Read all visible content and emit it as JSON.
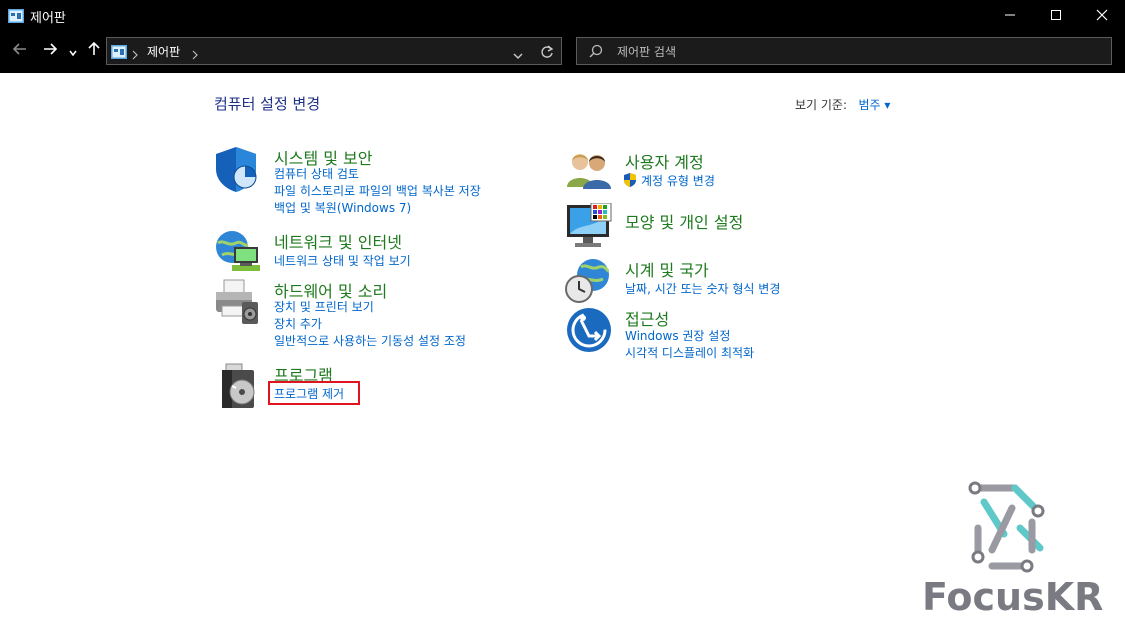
{
  "window": {
    "title": "제어판"
  },
  "address": {
    "crumb": "제어판"
  },
  "search": {
    "placeholder": "제어판 검색"
  },
  "main": {
    "heading": "컴퓨터 설정 변경",
    "view_by_label": "보기 기준:",
    "view_by_value": "범주"
  },
  "categories": [
    {
      "title": "시스템 및 보안",
      "links": [
        "컴퓨터 상태 검토",
        "파일 히스토리로 파일의 백업 복사본 저장",
        "백업 및 복원(Windows 7)"
      ]
    },
    {
      "title": "네트워크 및 인터넷",
      "links": [
        "네트워크 상태 및 작업 보기"
      ]
    },
    {
      "title": "하드웨어 및 소리",
      "links": [
        "장치 및 프린터 보기",
        "장치 추가",
        "일반적으로 사용하는 기동성 설정 조정"
      ]
    },
    {
      "title": "프로그램",
      "links": [
        "프로그램 제거"
      ]
    },
    {
      "title": "사용자 계정",
      "links": [
        "계정 유형 변경"
      ]
    },
    {
      "title": "모양 및 개인 설정",
      "links": []
    },
    {
      "title": "시계 및 국가",
      "links": [
        "날짜, 시간 또는 숫자 형식 변경"
      ]
    },
    {
      "title": "접근성",
      "links": [
        "Windows 권장 설정",
        "시각적 디스플레이 최적화"
      ]
    }
  ],
  "watermark": {
    "text": "FocusKR"
  },
  "colors": {
    "title_bg": "#000000",
    "category_title": "#1e7a1e",
    "link": "#0066cc",
    "highlight": "#e0141e"
  }
}
